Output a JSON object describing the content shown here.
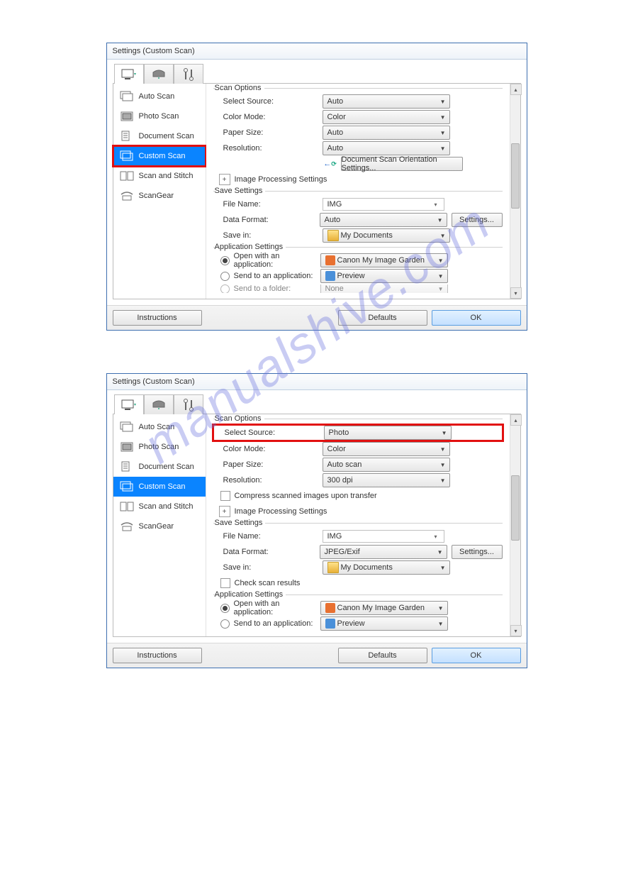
{
  "watermark": "manualshive.com",
  "dialog1": {
    "title": "Settings (Custom Scan)",
    "sidebar": [
      "Auto Scan",
      "Photo Scan",
      "Document Scan",
      "Custom Scan",
      "Scan and Stitch",
      "ScanGear"
    ],
    "scanOptions": {
      "title": "Scan Options",
      "selectSourceLabel": "Select Source:",
      "selectSource": "Auto",
      "colorModeLabel": "Color Mode:",
      "colorMode": "Color",
      "paperSizeLabel": "Paper Size:",
      "paperSize": "Auto",
      "resolutionLabel": "Resolution:",
      "resolution": "Auto",
      "orientBtn": "Document Scan Orientation Settings...",
      "ips": "Image Processing Settings"
    },
    "saveSettings": {
      "title": "Save Settings",
      "fileNameLabel": "File Name:",
      "fileName": "IMG",
      "dataFormatLabel": "Data Format:",
      "dataFormat": "Auto",
      "settingsBtn": "Settings...",
      "saveInLabel": "Save in:",
      "saveIn": "My Documents"
    },
    "appSettings": {
      "title": "Application Settings",
      "openWith": "Open with an application:",
      "openWithVal": "Canon My Image Garden",
      "sendTo": "Send to an application:",
      "sendToVal": "Preview",
      "sendFolder": "Send to a folder:",
      "sendFolderVal": "None"
    },
    "footer": {
      "instructions": "Instructions",
      "defaults": "Defaults",
      "ok": "OK"
    }
  },
  "dialog2": {
    "title": "Settings (Custom Scan)",
    "sidebar": [
      "Auto Scan",
      "Photo Scan",
      "Document Scan",
      "Custom Scan",
      "Scan and Stitch",
      "ScanGear"
    ],
    "scanOptions": {
      "title": "Scan Options",
      "selectSourceLabel": "Select Source:",
      "selectSource": "Photo",
      "colorModeLabel": "Color Mode:",
      "colorMode": "Color",
      "paperSizeLabel": "Paper Size:",
      "paperSize": "Auto scan",
      "resolutionLabel": "Resolution:",
      "resolution": "300 dpi",
      "compress": "Compress scanned images upon transfer",
      "ips": "Image Processing Settings"
    },
    "saveSettings": {
      "title": "Save Settings",
      "fileNameLabel": "File Name:",
      "fileName": "IMG",
      "dataFormatLabel": "Data Format:",
      "dataFormat": "JPEG/Exif",
      "settingsBtn": "Settings...",
      "saveInLabel": "Save in:",
      "saveIn": "My Documents",
      "checkResults": "Check scan results"
    },
    "appSettings": {
      "title": "Application Settings",
      "openWith": "Open with an application:",
      "openWithVal": "Canon My Image Garden",
      "sendTo": "Send to an application:",
      "sendToVal": "Preview"
    },
    "footer": {
      "instructions": "Instructions",
      "defaults": "Defaults",
      "ok": "OK"
    }
  }
}
